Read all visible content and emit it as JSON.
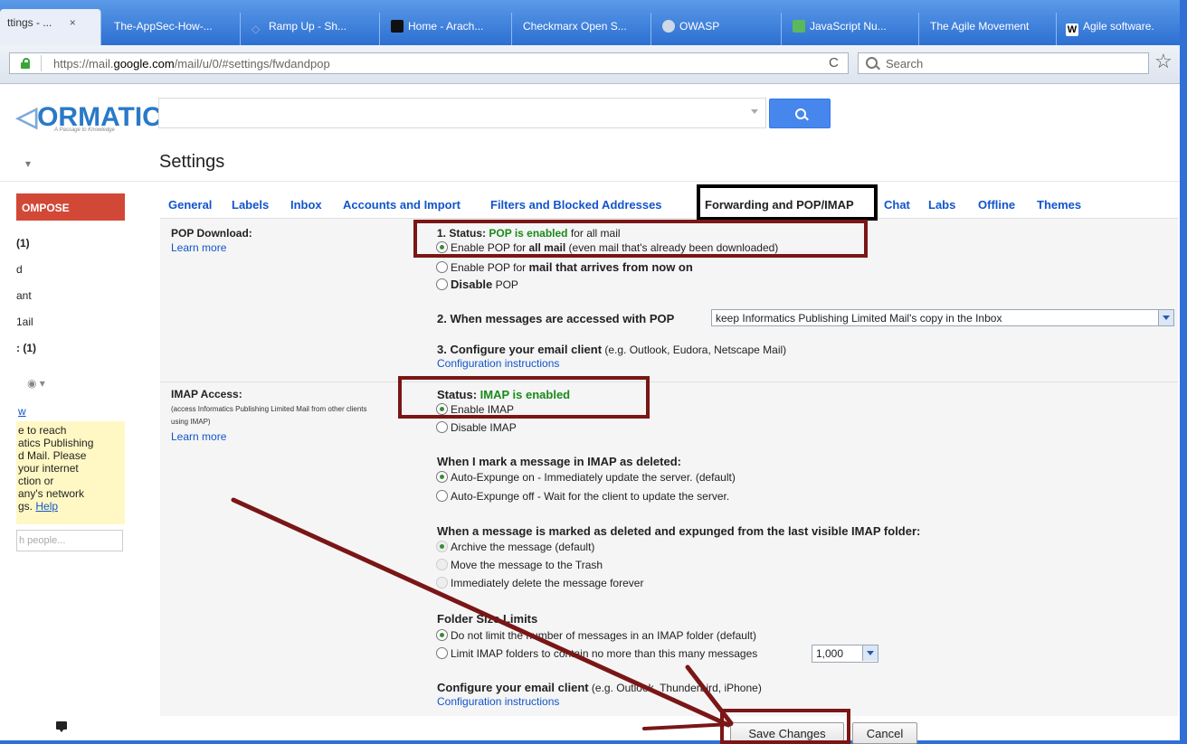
{
  "browser": {
    "tabs": [
      {
        "label": "ttings - ...",
        "close": "×"
      },
      {
        "label": "The-AppSec-How-..."
      },
      {
        "label": "Ramp Up - Sh..."
      },
      {
        "label": "Home - Arach..."
      },
      {
        "label": "Checkmarx Open S..."
      },
      {
        "label": "OWASP"
      },
      {
        "label": "JavaScript Nu..."
      },
      {
        "label": "The Agile Movement"
      },
      {
        "label": "Agile software."
      }
    ],
    "url_prefix": "https://mail.",
    "url_domain": "google.com",
    "url_rest": "/mail/u/0/#settings/fwdandpop",
    "reload": "C",
    "search_placeholder": "Search",
    "bookmark": "☆"
  },
  "gmail": {
    "logo": "ORMATICS",
    "logo_tagline": "A Passage to Knowledge",
    "search_value": "",
    "mail_menu": "▾",
    "page_title": "Settings",
    "compose": "OMPOSE",
    "nav": [
      {
        "label": "(1)"
      },
      {
        "label": "d"
      },
      {
        "label": "ant"
      },
      {
        "label": "1ail"
      },
      {
        "label": ": (1)"
      }
    ],
    "chat_status": "◉ ▾",
    "chat_link": "w",
    "chat_warning": "e to reach\natics Publishing\nd Mail. Please\nyour internet\nction or\nany's network\ngs.",
    "help_link": "Help",
    "people_placeholder": "h people...",
    "chat_icon": "chat-bubble"
  },
  "settings_tabs": [
    {
      "label": "General"
    },
    {
      "label": "Labels"
    },
    {
      "label": "Inbox"
    },
    {
      "label": "Accounts and Import"
    },
    {
      "label": "Filters and Blocked Addresses"
    },
    {
      "label": "Forwarding and POP/IMAP",
      "current": true
    },
    {
      "label": "Chat"
    },
    {
      "label": "Labs"
    },
    {
      "label": "Offline"
    },
    {
      "label": "Themes"
    }
  ],
  "pop": {
    "label": "POP Download:",
    "learn_more": "Learn more",
    "status_prefix": "1. Status: ",
    "status_value": "POP is enabled",
    "status_suffix": " for all mail",
    "options": [
      {
        "pre": "Enable POP for ",
        "bold": "all mail",
        "post": " (even mail that's already been downloaded)",
        "selected": true
      },
      {
        "pre": "Enable POP for ",
        "bold": "mail that arrives from now on",
        "post": "",
        "selected": false
      },
      {
        "pre": "",
        "bold": "Disable",
        "post": " POP",
        "selected": false
      }
    ],
    "step2_label": "2. When messages are accessed with POP",
    "step2_value": "keep Informatics Publishing Limited Mail's copy in the Inbox",
    "step3_label": "3. Configure your email client",
    "step3_hint": " (e.g. Outlook, Eudora, Netscape Mail)",
    "config_link": "Configuration instructions"
  },
  "imap": {
    "label": "IMAP Access:",
    "desc": "(access Informatics Publishing Limited Mail from other clients\nusing IMAP)",
    "learn_more": "Learn more",
    "status_prefix": "Status: ",
    "status_value": "IMAP is enabled",
    "enable": "Enable IMAP",
    "disable": "Disable IMAP",
    "deleted_heading": "When I mark a message in IMAP as deleted:",
    "deleted_opts": [
      {
        "label": "Auto-Expunge on - Immediately update the server. (default)",
        "selected": true
      },
      {
        "label": "Auto-Expunge off - Wait for the client to update the server.",
        "selected": false
      }
    ],
    "expunged_heading": "When a message is marked as deleted and expunged from the last visible IMAP folder:",
    "expunged_opts": [
      {
        "label": "Archive the message (default)"
      },
      {
        "label": "Move the message to the Trash"
      },
      {
        "label": "Immediately delete the message forever"
      }
    ],
    "folder_heading": "Folder Size Limits",
    "folder_opt1": "Do not limit the number of messages in an IMAP folder (default)",
    "folder_opt2": "Limit IMAP folders to contain no more than this many messages",
    "folder_limit": "1,000",
    "configure_label": "Configure your email client",
    "configure_hint": " (e.g. Outlook, Thunderbird, iPhone)",
    "config_link": "Configuration instructions"
  },
  "actions": {
    "save": "Save Changes",
    "cancel": "Cancel"
  },
  "colors": {
    "tabstrip": "#2d6fd2",
    "compose": "#d14836",
    "search_button": "#4787ed",
    "enabled_text": "#1a8a1a",
    "annotation": "#7a1616"
  }
}
